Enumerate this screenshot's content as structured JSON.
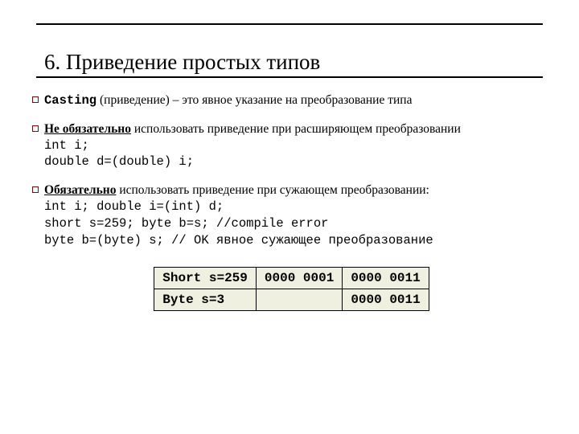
{
  "heading": "6. Приведение простых типов",
  "p1": {
    "casting": "Casting",
    "text": " (приведение) – это явное указание на преобразование типа"
  },
  "p2": {
    "lead_b": "Не обязательно",
    "lead_rest": " использовать приведение при расширяющем преобразовании",
    "code1": "int i;",
    "code2": "double d=(double) i;"
  },
  "p3": {
    "lead_b": "Обязательно",
    "lead_rest": " использовать приведение при сужающем преобразовании:",
    "code1": "int i; double i=(int) d;",
    "code2": "short s=259; byte b=s;    //compile error",
    "code3": "byte b=(byte) s;     // OK явное сужающее преобразование"
  },
  "table": {
    "r1c1": "Short s=259",
    "r1c2": "0000 0001",
    "r1c3": "0000 0011",
    "r2c1": "Byte s=3",
    "r2c2": "",
    "r2c3": "0000 0011"
  }
}
